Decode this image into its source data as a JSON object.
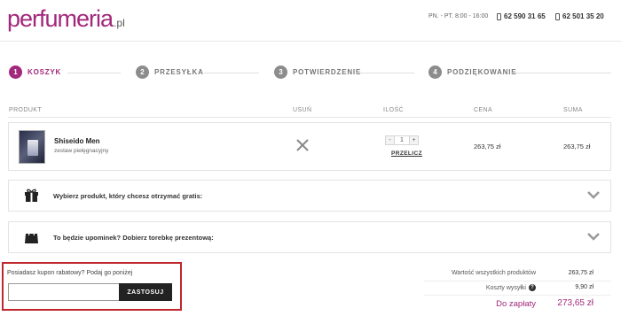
{
  "header": {
    "logo_main": "perfumeria",
    "logo_tld": ".pl",
    "hours": "PN. - PT. 8:00 - 16:00",
    "phone1": "62 590 31 65",
    "phone2": "62 501 35 20"
  },
  "steps": [
    {
      "number": "1",
      "label": "KOSZYK",
      "active": true
    },
    {
      "number": "2",
      "label": "PRZESYŁKA",
      "active": false
    },
    {
      "number": "3",
      "label": "POTWIERDZENIE",
      "active": false
    },
    {
      "number": "4",
      "label": "PODZIĘKOWANIE",
      "active": false
    }
  ],
  "table": {
    "headers": {
      "product": "PRODUKT",
      "remove": "USUŃ",
      "qty": "ILOŚĆ",
      "price": "CENA",
      "sum": "SUMA"
    }
  },
  "product": {
    "name": "Shiseido Men",
    "subtitle": "zestaw pielęgnacyjny",
    "qty_minus": "-",
    "quantity": "1",
    "qty_plus": "+",
    "recalc": "PRZELICZ",
    "price": "263,75 zł",
    "sum": "263,75 zł"
  },
  "panels": {
    "gift": "Wybierz produkt, który chcesz otrzymać gratis:",
    "bag": "To będzie upominek? Dobierz torebkę prezentową:"
  },
  "coupon": {
    "label": "Posiadasz kupon rabatowy? Podaj go poniżej",
    "input_value": "",
    "button": "ZASTOSUJ"
  },
  "summary": {
    "products_label": "Wartość wszystkich produktów",
    "products_value": "263,75 zł",
    "shipping_label": "Koszty wysyłki",
    "shipping_help": "?",
    "shipping_value": "9,90 zł",
    "total_label": "Do zapłaty",
    "total_value": "273,65 zł"
  },
  "colors": {
    "brand": "#a3287b",
    "highlight_border": "#c0262d",
    "button_bg": "#222222"
  }
}
